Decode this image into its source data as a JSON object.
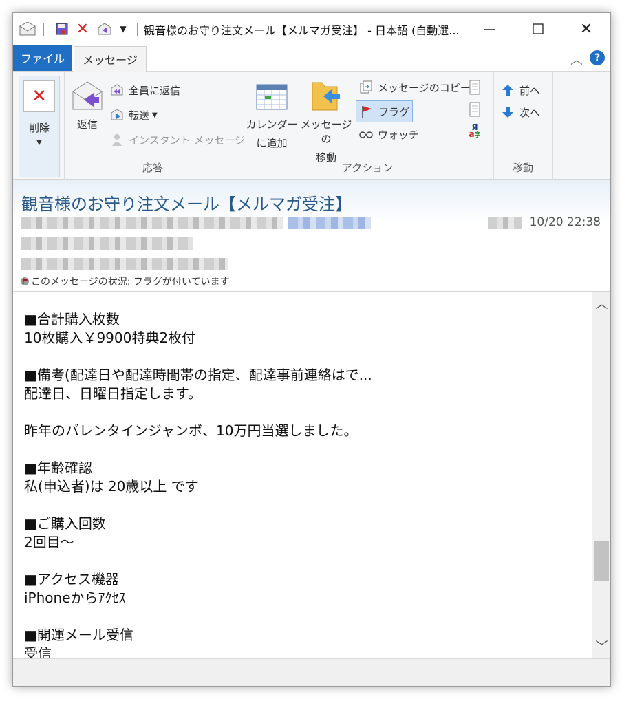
{
  "window": {
    "title": "観音様のお守り注文メール【メルマガ受注】 - 日本語 (自動選..."
  },
  "tabs": [
    {
      "label": "ファイル"
    },
    {
      "label": "メッセージ"
    }
  ],
  "ribbon": {
    "delete": {
      "label": "削除"
    },
    "reply": {
      "label": "返信"
    },
    "reply_all": {
      "label": "全員に返信"
    },
    "forward": {
      "label": "転送"
    },
    "instant_message": {
      "label": "インスタント メッセージ"
    },
    "group_respond": "応答",
    "calendar": {
      "line1": "カレンダー",
      "line2": "に追加"
    },
    "move_message": {
      "line1": "メッセージの",
      "line2": "移動"
    },
    "copy_message": {
      "label": "メッセージのコピー"
    },
    "flag": {
      "label": "フラグ"
    },
    "watch": {
      "label": "ウォッチ"
    },
    "group_action": "アクション",
    "previous": {
      "label": "前へ"
    },
    "next": {
      "label": "次へ"
    },
    "group_move": "移動"
  },
  "header": {
    "subject": "観音様のお守り注文メール【メルマガ受注】",
    "date": "10/20 22:38",
    "status": "このメッセージの状況: フラグが付いています"
  },
  "body": {
    "lines": [
      "",
      "■合計購入枚数",
      "10枚購入￥9900特典2枚付",
      "",
      "■備考(配達日や配達時間帯の指定、配達事前連絡はで...",
      "配達日、日曜日指定します。",
      "",
      "昨年のバレンタインジャンボ、10万円当選しました。",
      "",
      "■年齢確認",
      "私(申込者)は 20歳以上 です",
      "",
      "■ご購入回数",
      "2回目～",
      "",
      "■アクセス機器",
      "iPhoneからｱｸｾｽ",
      "",
      "■開運メール受信",
      "受信"
    ]
  },
  "colors": {
    "accent": "#1f6fc5",
    "subject": "#2a5a8a",
    "ribbon_bg": "#f5f6f7"
  }
}
